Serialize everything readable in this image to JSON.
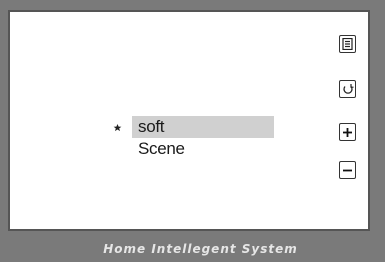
{
  "footer": {
    "title": "Home Intellegent System"
  },
  "scene_list": {
    "items": [
      {
        "label": "soft",
        "selected": true
      },
      {
        "label": "Scene",
        "selected": false
      }
    ]
  },
  "side_buttons": [
    {
      "icon": "document-icon"
    },
    {
      "icon": "refresh-icon"
    },
    {
      "icon": "plus-icon"
    },
    {
      "icon": "minus-icon"
    }
  ],
  "mode_icon": "moon-star-icon"
}
